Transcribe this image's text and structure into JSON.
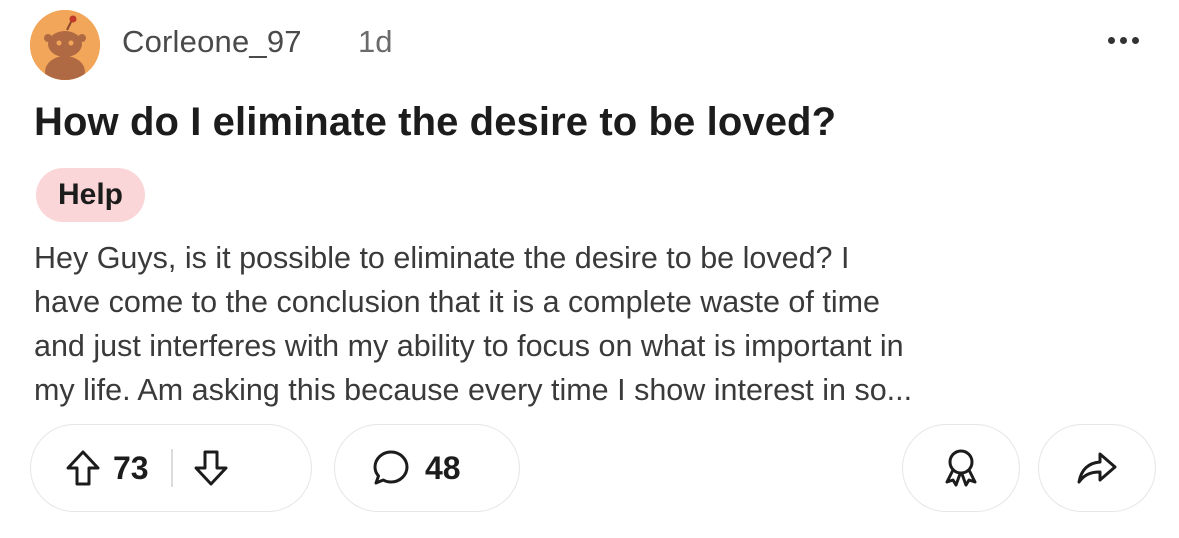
{
  "post": {
    "author": "Corleone_97",
    "age": "1d",
    "title": "How do I eliminate the desire to be loved?",
    "flair": "Help",
    "body_lines": [
      "Hey Guys, is it possible to eliminate the desire to be loved? I",
      "have come to the conclusion that it is a complete waste of time",
      "and just interferes with my ability to focus on what is important in",
      "my life. Am asking this because every time I show interest in so..."
    ]
  },
  "actions": {
    "upvotes": "73",
    "comments": "48"
  },
  "icons": {
    "avatar": "snoo-avatar-icon",
    "more": "more-options-icon",
    "upvote": "upvote-arrow-icon",
    "downvote": "downvote-arrow-icon",
    "comment": "comment-bubble-icon",
    "award": "award-icon",
    "share": "share-arrow-icon"
  },
  "colors": {
    "avatar_bg": "#f2a65a",
    "flair_bg": "#fbd6d8",
    "text": "#1a1a1b"
  }
}
